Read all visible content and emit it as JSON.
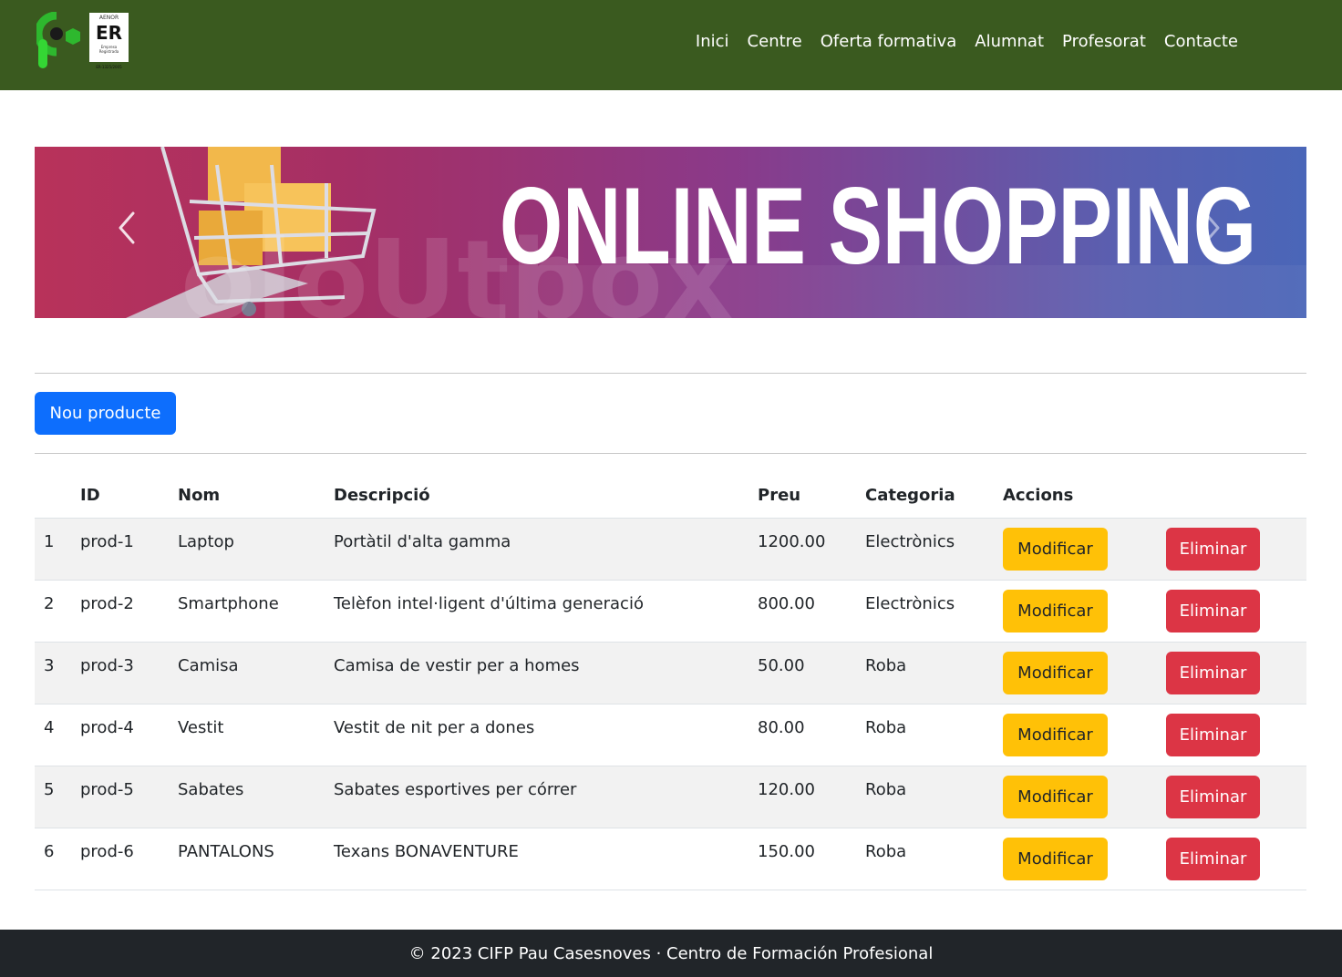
{
  "nav": {
    "logo_text": "AENOR ER Empresa Registrada ER-1325/2005",
    "links": [
      "Inici",
      "Centre",
      "Oferta formativa",
      "Alumnat",
      "Profesorat",
      "Contacte"
    ]
  },
  "carousel": {
    "banner_text": "ONLINE SHOPPING",
    "prev_icon": "chevron-left-icon",
    "next_icon": "chevron-right-icon"
  },
  "actions": {
    "new_product_label": "Nou producte"
  },
  "table": {
    "headers": [
      "",
      "ID",
      "Nom",
      "Descripció",
      "Preu",
      "Categoria",
      "Accions",
      ""
    ],
    "modify_label": "Modificar",
    "delete_label": "Eliminar",
    "rows": [
      {
        "n": "1",
        "id": "prod-1",
        "name": "Laptop",
        "desc": "Portàtil d'alta gamma",
        "price": "1200.00",
        "cat": "Electrònics"
      },
      {
        "n": "2",
        "id": "prod-2",
        "name": "Smartphone",
        "desc": "Telèfon intel·ligent d'última generació",
        "price": "800.00",
        "cat": "Electrònics"
      },
      {
        "n": "3",
        "id": "prod-3",
        "name": "Camisa",
        "desc": "Camisa de vestir per a homes",
        "price": "50.00",
        "cat": "Roba"
      },
      {
        "n": "4",
        "id": "prod-4",
        "name": "Vestit",
        "desc": "Vestit de nit per a dones",
        "price": "80.00",
        "cat": "Roba"
      },
      {
        "n": "5",
        "id": "prod-5",
        "name": "Sabates",
        "desc": "Sabates esportives per córrer",
        "price": "120.00",
        "cat": "Roba"
      },
      {
        "n": "6",
        "id": "prod-6",
        "name": "PANTALONS",
        "desc": "Texans BONAVENTURE",
        "price": "150.00",
        "cat": "Roba"
      }
    ]
  },
  "footer": {
    "text": "© 2023 CIFP Pau Casesnoves · Centro de Formación Profesional"
  },
  "colors": {
    "navbar": "#3a5a1f",
    "primary": "#0d6efd",
    "warning": "#ffc107",
    "danger": "#dc3545",
    "footer": "#212529"
  }
}
